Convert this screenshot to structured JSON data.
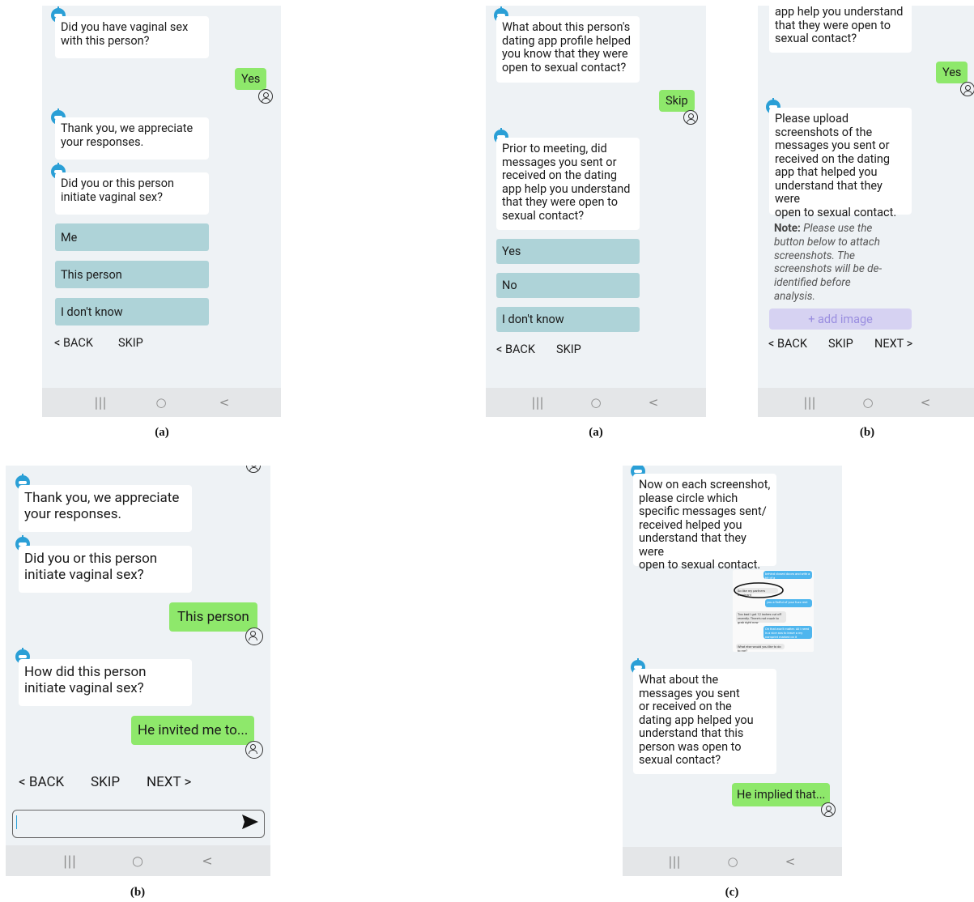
{
  "screen_a1": {
    "caption": "(a)",
    "msg1": "Did you have vaginal sex\nwith this person?",
    "reply1": "Yes",
    "msg2": "Thank you, we appreciate\nyour responses.",
    "msg3": "Did you or this person\ninitiate vaginal sex?",
    "options": [
      "Me",
      "This person",
      "I don't know"
    ],
    "back": "< BACK",
    "skip": "SKIP"
  },
  "screen_a2": {
    "caption": "(a)",
    "msg1": "What about this person's\ndating app profile helped\nyou know that they were\nopen to sexual contact?",
    "reply1": "Skip",
    "msg2": "Prior to meeting, did\nmessages you sent or\nreceived on the dating\napp help you understand\nthat they were open to\nsexual contact?",
    "options": [
      "Yes",
      "No",
      "I don't know"
    ],
    "back": "< BACK",
    "skip": "SKIP"
  },
  "screen_b1": {
    "caption": "(b)",
    "msg_top": "app help you understand\nthat they were open to\nsexual contact?",
    "reply1": "Yes",
    "msg2": "Please upload\nscreenshots of the\nmessages you sent or\nreceived on the dating\napp that helped you\nunderstand that they were\nopen to sexual contact.",
    "note_label": "Note:",
    "note_text": "Please use the button below to attach screenshots. The screenshots will be de-identified before analysis.",
    "add_image": "+ add image",
    "back": "< BACK",
    "skip": "SKIP",
    "next": "NEXT >"
  },
  "screen_b2": {
    "caption": "(b)",
    "msg1": "Thank you, we appreciate\nyour responses.",
    "msg2": "Did you or this person\ninitiate vaginal sex?",
    "reply1": "This person",
    "msg3": "How did this person\ninitiate vaginal sex?",
    "reply2": "He invited me to...",
    "back": "< BACK",
    "skip": "SKIP",
    "next": "NEXT >",
    "input_value": ""
  },
  "screen_c": {
    "caption": "(c)",
    "msg1": "Now on each screenshot,\nplease circle which\nspecific messages sent/\nreceived helped you\nunderstand that they were\nopen to sexual contact.",
    "shot_lines": [
      "behind closed doors and with a bit of a",
      "So like my partners dominant",
      "you a fistful of your fuzz rent",
      "Too bad I got 12 inches cut off recently. There's not much to grab right now",
      "Oh that won't matter. All I need is a nice ass to leave a my namprint marked on it",
      "What else would you like to do to me?"
    ],
    "msg2": "What about the\nmessages you sent\nor received on the\ndating app helped you\nunderstand that this\nperson was open to\nsexual contact?",
    "reply1": "He implied that..."
  },
  "navbar": {
    "recent": "|||",
    "home": "○",
    "back": "<"
  },
  "colors": {
    "phone_bg": "#eef2f5",
    "bot_accent": "#2a9fd6",
    "user_bubble": "#8ee86b",
    "option_bg": "#aed3d8",
    "add_image_bg": "#d6d2f2"
  }
}
